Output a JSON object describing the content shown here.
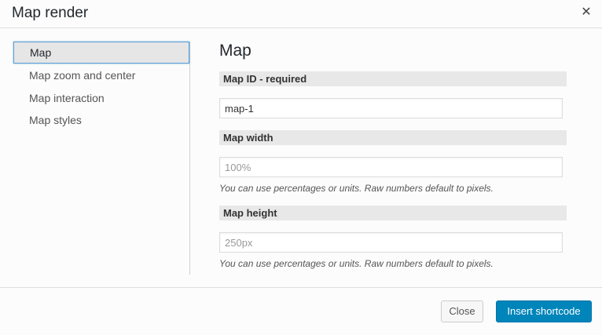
{
  "dialog": {
    "title": "Map render",
    "close_icon": "close-icon"
  },
  "sidebar": {
    "items": [
      {
        "label": "Map",
        "active": true
      },
      {
        "label": "Map zoom and center",
        "active": false
      },
      {
        "label": "Map interaction",
        "active": false
      },
      {
        "label": "Map styles",
        "active": false
      }
    ]
  },
  "main": {
    "section_title": "Map",
    "fields": [
      {
        "label": "Map ID - required",
        "value": "map-1",
        "placeholder": ""
      },
      {
        "label": "Map width",
        "value": "",
        "placeholder": "100%",
        "hint": "You can use percentages or units. Raw numbers default to pixels."
      },
      {
        "label": "Map height",
        "value": "",
        "placeholder": "250px",
        "hint": "You can use percentages or units. Raw numbers default to pixels."
      }
    ]
  },
  "footer": {
    "close_label": "Close",
    "insert_label": "Insert shortcode"
  },
  "colors": {
    "accent": "#0085ba",
    "focus_border": "#5b9dd9"
  }
}
